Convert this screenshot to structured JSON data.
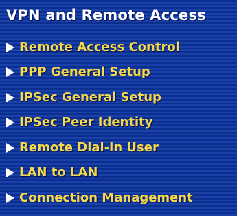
{
  "menu": {
    "title": "VPN and Remote Access",
    "items": [
      {
        "label": "Remote Access Control"
      },
      {
        "label": "PPP General Setup"
      },
      {
        "label": "IPSec General Setup"
      },
      {
        "label": "IPSec Peer Identity"
      },
      {
        "label": "Remote Dial-in User"
      },
      {
        "label": "LAN to LAN"
      },
      {
        "label": "Connection Management"
      }
    ]
  },
  "colors": {
    "panel_background": "#0a2f8f",
    "title_text": "#ffffff",
    "item_text": "#f5d94a",
    "arrow": "#ffffff"
  },
  "icons": {
    "item_arrow": "right-triangle-icon"
  }
}
